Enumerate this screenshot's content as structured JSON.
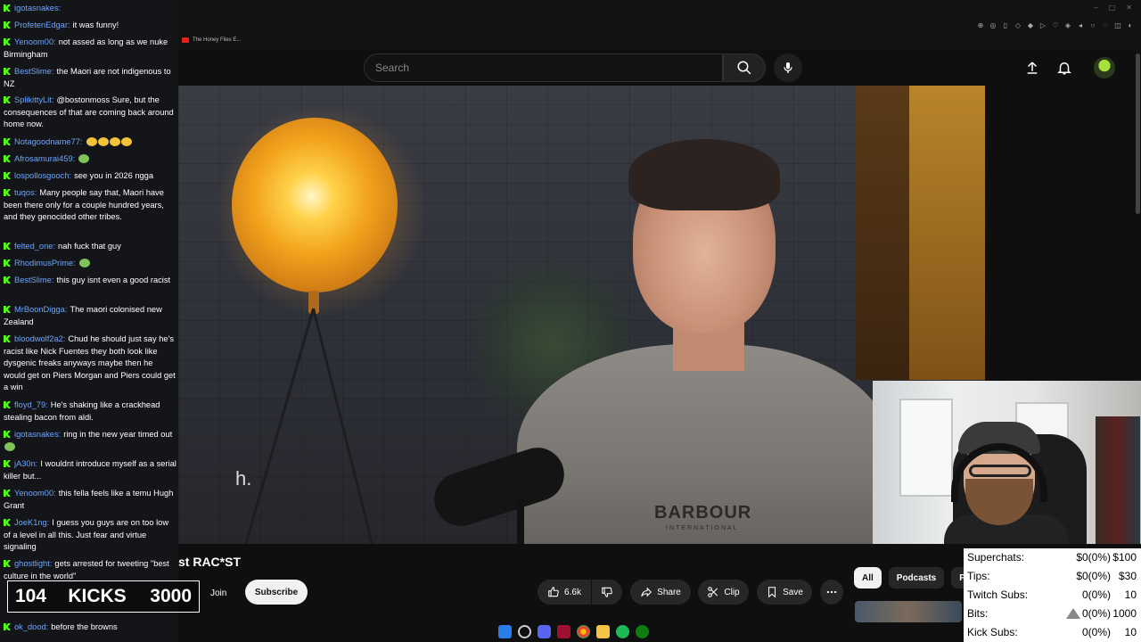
{
  "browser": {
    "tab_title": "The Honey Files E..."
  },
  "youtube_header": {
    "search_placeholder": "Search",
    "icons": [
      "search-icon",
      "mic-icon",
      "upload-icon",
      "bell-icon",
      "avatar"
    ]
  },
  "video": {
    "caption": "h.",
    "shirt_brand": "BARBOUR",
    "shirt_brand_sub": "INTERNATIONAL",
    "title": "st RAC*ST"
  },
  "channel": {
    "join_label": "Join",
    "subscribe_label": "Subscribe"
  },
  "actions": {
    "likes": "6.6k",
    "share": "Share",
    "clip": "Clip",
    "save": "Save"
  },
  "chips": [
    "All",
    "Podcasts",
    "P"
  ],
  "chat": [
    {
      "user": "igotasnakes",
      "text": ""
    },
    {
      "user": "ProfetenEdgar",
      "text": "it was funny!"
    },
    {
      "user": "Yenoom00",
      "text": "not assed as long as we nuke Birmingham"
    },
    {
      "user": "BestSlime",
      "text": "the Maori are not indigenous to NZ"
    },
    {
      "user": "SplikittyLit",
      "text": "@bostonmoss Sure, but the consequences of that are coming back around home now."
    },
    {
      "user": "Notagoodname77",
      "text": "",
      "emotes": 4,
      "emote_kind": "laugh"
    },
    {
      "user": "Afrosamurai459",
      "text": "",
      "emotes": 1,
      "emote_kind": "green"
    },
    {
      "user": "lospollosgooch",
      "text": "see you in 2026 ngga"
    },
    {
      "user": "tuqos",
      "text": "Many people say that, Maori have been there only for a couple hundred years, and they genocided other tribes."
    },
    {
      "user": "felted_one",
      "text": "nah fuck that guy"
    },
    {
      "user": "RhodimusPrime",
      "text": "",
      "emotes": 1,
      "emote_kind": "green"
    },
    {
      "user": "BestSlime",
      "text": "this guy isnt even a good racist"
    },
    {
      "user": "MrBoonDigga",
      "text": "The maori colonised new Zealand"
    },
    {
      "user": "bloodwolf2a2",
      "text": "Chud he should just say he's racist like Nick Fuentes they both look like dysgenic freaks anyways maybe then he would get on Piers Morgan and Piers could get a win"
    },
    {
      "user": "floyd_79",
      "text": "He's shaking like a crackhead stealing bacon from aldi."
    },
    {
      "user": "igotasnakes",
      "text": "ring in the new year timed out",
      "emotes": 1,
      "emote_kind": "green"
    },
    {
      "user": "jA30n",
      "text": "I wouldnt introduce myself as a serial killer but..."
    },
    {
      "user": "Yenoom00",
      "text": "this fella feels like a temu Hugh Grant"
    },
    {
      "user": "JoeK1ng",
      "text": "I guess you guys are on too low of a level in all this. Just fear and virtue signaling"
    },
    {
      "user": "ghostlight",
      "text": "gets arrested for tweeting \"best culture in the world\""
    },
    {
      "user": "ok_dood",
      "text": "before the browns"
    }
  ],
  "kicks": {
    "count": "104",
    "label": "KICKS",
    "goal": "3000"
  },
  "goals": [
    {
      "label": "Superchats:",
      "value": "$0(0%)",
      "max": "$100"
    },
    {
      "label": "Tips:",
      "value": "$0(0%)",
      "max": "$30"
    },
    {
      "label": "Twitch Subs:",
      "value": "0(0%)",
      "max": "10"
    },
    {
      "label": "Bits:",
      "value": "0(0%)",
      "max": "1000"
    },
    {
      "label": "Kick Subs:",
      "value": "0(0%)",
      "max": "10"
    }
  ],
  "colors": {
    "kick_green": "#53fc18",
    "username_blue": "#6aa6ff",
    "youtube_red": "#e62117"
  }
}
